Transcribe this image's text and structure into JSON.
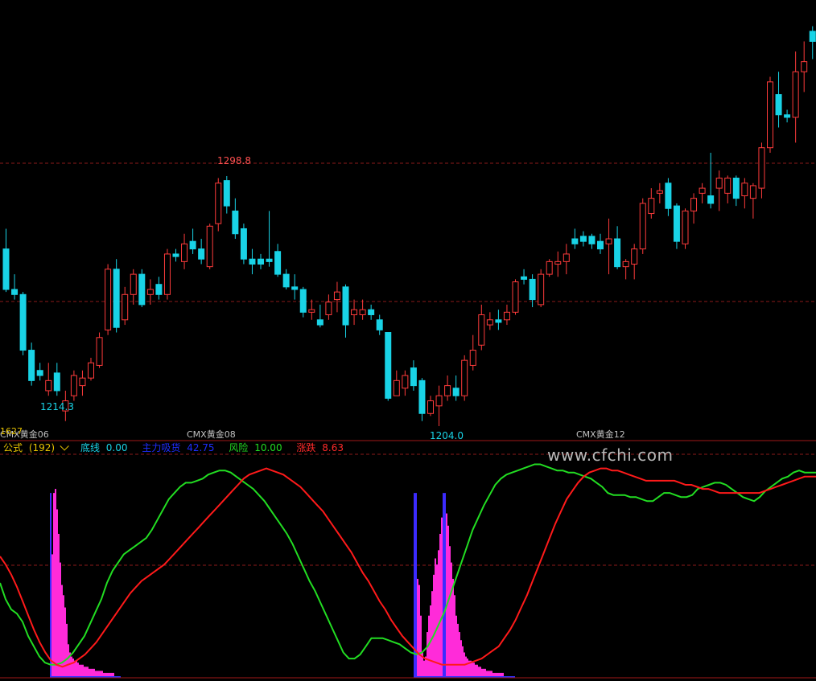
{
  "price_chart": {
    "high_label": "1298.8",
    "low_label_1": "1214.3",
    "low_label_2": "1204.0",
    "corner_label": "1627",
    "contracts": [
      "CMX黄金06",
      "CMX黄金08",
      "CMX黄金12"
    ],
    "colors": {
      "up": "#ff3b3b",
      "down": "#19d3e6",
      "grid": "#8b1a1a"
    },
    "candles": [
      [
        1270,
        1278,
        1253,
        1254
      ],
      [
        1254,
        1260,
        1250,
        1252
      ],
      [
        1252,
        1253,
        1228,
        1230
      ],
      [
        1230,
        1233,
        1216,
        1218
      ],
      [
        1222,
        1225,
        1218,
        1220
      ],
      [
        1214,
        1225,
        1212,
        1218
      ],
      [
        1221,
        1225,
        1212,
        1214
      ],
      [
        1206,
        1214,
        1202,
        1210
      ],
      [
        1212,
        1222,
        1210,
        1220
      ],
      [
        1216,
        1222,
        1212,
        1219
      ],
      [
        1219,
        1227,
        1218,
        1225
      ],
      [
        1224,
        1237,
        1223,
        1235
      ],
      [
        1238,
        1264,
        1236,
        1262
      ],
      [
        1262,
        1266,
        1237,
        1239
      ],
      [
        1242,
        1255,
        1240,
        1252
      ],
      [
        1252,
        1262,
        1248,
        1260
      ],
      [
        1260,
        1262,
        1247,
        1248
      ],
      [
        1252,
        1258,
        1248,
        1254
      ],
      [
        1256,
        1259,
        1250,
        1252
      ],
      [
        1252,
        1270,
        1250,
        1268
      ],
      [
        1268,
        1270,
        1265,
        1267
      ],
      [
        1265,
        1276,
        1262,
        1272
      ],
      [
        1273,
        1278,
        1268,
        1270
      ],
      [
        1270,
        1274,
        1264,
        1266
      ],
      [
        1263,
        1280,
        1262,
        1279
      ],
      [
        1280,
        1298,
        1277,
        1296
      ],
      [
        1297,
        1298.8,
        1284,
        1287
      ],
      [
        1285,
        1290,
        1274,
        1276
      ],
      [
        1278,
        1280,
        1264,
        1266
      ],
      [
        1266,
        1270,
        1260,
        1264
      ],
      [
        1266,
        1268,
        1262,
        1264
      ],
      [
        1266,
        1285,
        1263,
        1265
      ],
      [
        1269,
        1272,
        1259,
        1260
      ],
      [
        1260,
        1262,
        1254,
        1255
      ],
      [
        1255,
        1260,
        1250,
        1254
      ],
      [
        1254,
        1255,
        1243,
        1245
      ],
      [
        1245,
        1250,
        1242,
        1246
      ],
      [
        1242,
        1248,
        1239,
        1240
      ],
      [
        1244,
        1252,
        1242,
        1249
      ],
      [
        1250,
        1257,
        1245,
        1253
      ],
      [
        1255,
        1256,
        1235,
        1240
      ],
      [
        1244,
        1250,
        1240,
        1246
      ],
      [
        1244,
        1250,
        1242,
        1246
      ],
      [
        1246,
        1248,
        1242,
        1244
      ],
      [
        1242,
        1244,
        1236,
        1238
      ],
      [
        1237,
        1237,
        1210,
        1211
      ],
      [
        1212,
        1222,
        1212,
        1218
      ],
      [
        1215,
        1222,
        1212,
        1220
      ],
      [
        1223,
        1226,
        1214,
        1216
      ],
      [
        1218,
        1219,
        1202,
        1205
      ],
      [
        1205,
        1212,
        1204,
        1210
      ],
      [
        1208,
        1216,
        1200,
        1212
      ],
      [
        1212,
        1220,
        1210,
        1216
      ],
      [
        1215,
        1220,
        1210,
        1212
      ],
      [
        1212,
        1228,
        1210,
        1226
      ],
      [
        1224,
        1236,
        1222,
        1230
      ],
      [
        1232,
        1248,
        1230,
        1244
      ],
      [
        1240,
        1245,
        1238,
        1242
      ],
      [
        1242,
        1246,
        1238,
        1241
      ],
      [
        1242,
        1248,
        1240,
        1245
      ],
      [
        1245,
        1258,
        1244,
        1257
      ],
      [
        1259,
        1262,
        1256,
        1258
      ],
      [
        1258,
        1260,
        1247,
        1250
      ],
      [
        1248,
        1262,
        1247,
        1260
      ],
      [
        1260,
        1266,
        1259,
        1265
      ],
      [
        1264,
        1269,
        1259,
        1265
      ],
      [
        1265,
        1272,
        1260,
        1268
      ],
      [
        1274,
        1278,
        1270,
        1272
      ],
      [
        1275,
        1277,
        1271,
        1273
      ],
      [
        1275,
        1276,
        1270,
        1272
      ],
      [
        1273,
        1276,
        1268,
        1270
      ],
      [
        1272,
        1282,
        1260,
        1274
      ],
      [
        1274,
        1279,
        1262,
        1263
      ],
      [
        1263,
        1266,
        1258,
        1265
      ],
      [
        1264,
        1272,
        1258,
        1270
      ],
      [
        1270,
        1290,
        1268,
        1288
      ],
      [
        1284,
        1294,
        1282,
        1290
      ],
      [
        1292,
        1296,
        1288,
        1293
      ],
      [
        1296,
        1298,
        1283,
        1286
      ],
      [
        1287,
        1288,
        1270,
        1273
      ],
      [
        1272,
        1286,
        1270,
        1285
      ],
      [
        1285,
        1292,
        1280,
        1290
      ],
      [
        1292,
        1296,
        1288,
        1294
      ],
      [
        1291,
        1308,
        1286,
        1288
      ],
      [
        1294,
        1301,
        1285,
        1298
      ],
      [
        1292,
        1299,
        1288,
        1298
      ],
      [
        1298,
        1299,
        1287,
        1290
      ],
      [
        1291,
        1298,
        1286,
        1296
      ],
      [
        1290,
        1296,
        1282,
        1295
      ],
      [
        1294,
        1312,
        1290,
        1310
      ],
      [
        1310,
        1338,
        1308,
        1336
      ],
      [
        1331,
        1340,
        1318,
        1323
      ],
      [
        1323,
        1325,
        1320,
        1322
      ],
      [
        1322,
        1348,
        1312,
        1340
      ],
      [
        1340,
        1352,
        1332,
        1344
      ],
      [
        1356,
        1358,
        1345,
        1352
      ],
      [
        1352,
        1370,
        1346,
        1364
      ],
      [
        1365,
        1368,
        1352,
        1358
      ]
    ]
  },
  "indicator": {
    "title": "公式",
    "param": "(192)",
    "items": [
      {
        "label": "底线",
        "value": "0.00",
        "color": "#19d3e6"
      },
      {
        "label": "主力吸货",
        "value": "42.75",
        "color": "#1e2dff"
      },
      {
        "label": "风险",
        "value": "10.00",
        "color": "#22dd22"
      },
      {
        "label": "涨跌",
        "value": "8.63",
        "color": "#ff2a2a"
      }
    ],
    "title_color": "#e6c200",
    "watermark": "www.cfchi.com",
    "risk_line": [
      46,
      38,
      33,
      31,
      27,
      20,
      15,
      10,
      7,
      6,
      6,
      7,
      9,
      12,
      16,
      20,
      26,
      32,
      38,
      46,
      52,
      56,
      60,
      62,
      64,
      66,
      68,
      72,
      77,
      82,
      87,
      90,
      93,
      95,
      95,
      96,
      97,
      99,
      100,
      101,
      101,
      100,
      98,
      96,
      94,
      92,
      89,
      86,
      82,
      78,
      74,
      70,
      65,
      59,
      53,
      47,
      42,
      36,
      30,
      24,
      18,
      12,
      9,
      9,
      11,
      15,
      19,
      19,
      19,
      18,
      17,
      16,
      14,
      12,
      11,
      12,
      15,
      20,
      26,
      32,
      40,
      48,
      56,
      64,
      72,
      78,
      84,
      89,
      94,
      97,
      99,
      100,
      101,
      102,
      103,
      104,
      104,
      103,
      102,
      101,
      101,
      100,
      100,
      99,
      98,
      97,
      95,
      93,
      90,
      89,
      89,
      89,
      88,
      88,
      87,
      86,
      86,
      88,
      90,
      90,
      89,
      88,
      88,
      89,
      92,
      93,
      94,
      95,
      95,
      94,
      92,
      90,
      88,
      87,
      86,
      88,
      91,
      93,
      95,
      97,
      98,
      100,
      101,
      100,
      100,
      100
    ],
    "trend_line": [
      59,
      55,
      50,
      44,
      37,
      30,
      23,
      17,
      12,
      8,
      6,
      5,
      6,
      7,
      9,
      11,
      14,
      17,
      21,
      25,
      29,
      33,
      37,
      41,
      44,
      47,
      49,
      51,
      53,
      55,
      58,
      61,
      64,
      67,
      70,
      73,
      76,
      79,
      82,
      85,
      88,
      91,
      94,
      97,
      99,
      100,
      101,
      102,
      101,
      100,
      99,
      97,
      95,
      93,
      90,
      87,
      84,
      81,
      77,
      73,
      69,
      65,
      61,
      56,
      51,
      47,
      42,
      37,
      33,
      28,
      24,
      20,
      17,
      14,
      11,
      9,
      8,
      7,
      6,
      6,
      6,
      6,
      6,
      7,
      8,
      9,
      11,
      13,
      15,
      19,
      23,
      28,
      34,
      40,
      47,
      54,
      61,
      68,
      75,
      81,
      87,
      91,
      95,
      98,
      100,
      101,
      102,
      102,
      101,
      101,
      100,
      99,
      98,
      97,
      96,
      96,
      96,
      96,
      96,
      96,
      95,
      94,
      94,
      93,
      92,
      92,
      91,
      90,
      90,
      90,
      90,
      90,
      90,
      90,
      90,
      91,
      92,
      93,
      94,
      95,
      96,
      97,
      98,
      98,
      98
    ],
    "histogram": [
      [
        62,
        10
      ],
      [
        64,
        60
      ],
      [
        66,
        90
      ],
      [
        68,
        92
      ],
      [
        70,
        82
      ],
      [
        72,
        70
      ],
      [
        74,
        56
      ],
      [
        76,
        45
      ],
      [
        78,
        40
      ],
      [
        80,
        34
      ],
      [
        82,
        26
      ],
      [
        84,
        16
      ],
      [
        86,
        12
      ],
      [
        88,
        10
      ],
      [
        90,
        9
      ],
      [
        92,
        8
      ],
      [
        94,
        8
      ],
      [
        96,
        7
      ],
      [
        98,
        6
      ],
      [
        100,
        6
      ],
      [
        102,
        6
      ],
      [
        104,
        5
      ],
      [
        106,
        5
      ],
      [
        108,
        5
      ],
      [
        110,
        4
      ],
      [
        112,
        4
      ],
      [
        114,
        4
      ],
      [
        116,
        4
      ],
      [
        118,
        3
      ],
      [
        120,
        3
      ],
      [
        122,
        3
      ],
      [
        124,
        3
      ],
      [
        126,
        3
      ],
      [
        128,
        2
      ],
      [
        130,
        2
      ],
      [
        132,
        2
      ],
      [
        134,
        2
      ],
      [
        136,
        2
      ],
      [
        138,
        2
      ],
      [
        140,
        2
      ],
      [
        514,
        40
      ],
      [
        516,
        44
      ],
      [
        518,
        48
      ],
      [
        520,
        45
      ],
      [
        522,
        30
      ],
      [
        524,
        12
      ],
      [
        526,
        8
      ],
      [
        528,
        10
      ],
      [
        530,
        22
      ],
      [
        532,
        30
      ],
      [
        534,
        35
      ],
      [
        536,
        42
      ],
      [
        538,
        50
      ],
      [
        540,
        58
      ],
      [
        542,
        55
      ],
      [
        544,
        62
      ],
      [
        546,
        70
      ],
      [
        548,
        78
      ],
      [
        550,
        82
      ],
      [
        552,
        84
      ],
      [
        554,
        80
      ],
      [
        556,
        74
      ],
      [
        558,
        64
      ],
      [
        560,
        56
      ],
      [
        562,
        48
      ],
      [
        564,
        40
      ],
      [
        566,
        30
      ],
      [
        568,
        26
      ],
      [
        570,
        22
      ],
      [
        572,
        18
      ],
      [
        574,
        15
      ],
      [
        576,
        12
      ],
      [
        578,
        10
      ],
      [
        580,
        9
      ],
      [
        582,
        8
      ],
      [
        584,
        8
      ],
      [
        586,
        7
      ],
      [
        588,
        7
      ],
      [
        590,
        6
      ],
      [
        592,
        6
      ],
      [
        594,
        5
      ],
      [
        596,
        5
      ],
      [
        598,
        4
      ],
      [
        600,
        4
      ],
      [
        602,
        4
      ],
      [
        604,
        3
      ],
      [
        606,
        3
      ],
      [
        608,
        3
      ],
      [
        610,
        3
      ],
      [
        612,
        2
      ],
      [
        614,
        2
      ],
      [
        616,
        2
      ],
      [
        618,
        2
      ],
      [
        620,
        2
      ],
      [
        622,
        2
      ],
      [
        624,
        2
      ]
    ]
  }
}
